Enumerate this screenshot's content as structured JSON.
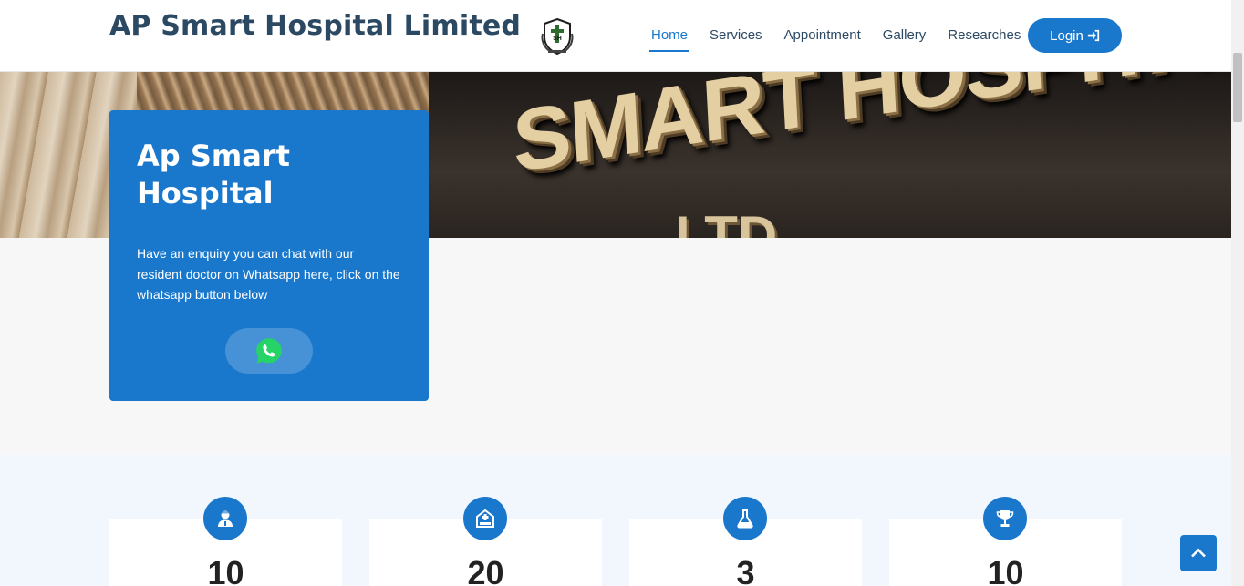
{
  "header": {
    "brand": "AP Smart Hospital Limited",
    "logo_icon": "hospital-crest-logo",
    "nav": [
      {
        "label": "Home",
        "active": true
      },
      {
        "label": "Services",
        "active": false
      },
      {
        "label": "Appointment",
        "active": false
      },
      {
        "label": "Gallery",
        "active": false
      },
      {
        "label": "Researches",
        "active": false
      }
    ],
    "login_label": "Login",
    "login_icon": "sign-in-icon"
  },
  "hero": {
    "sign_text": "SMART HOSPITAL",
    "sign_text_2": "LTD"
  },
  "card": {
    "title": "Ap Smart Hospital",
    "text": "Have an enquiry you can chat with our resident doctor on Whatsapp here, click on the whatsapp button below",
    "button_icon": "whatsapp-icon"
  },
  "counts": [
    {
      "icon": "doctor-icon",
      "value": "10"
    },
    {
      "icon": "hospital-bed-icon",
      "value": "20"
    },
    {
      "icon": "flask-icon",
      "value": "3"
    },
    {
      "icon": "trophy-icon",
      "value": "10"
    }
  ],
  "colors": {
    "primary": "#1977cc",
    "heading": "#2c4964",
    "whatsapp": "#25d366"
  }
}
